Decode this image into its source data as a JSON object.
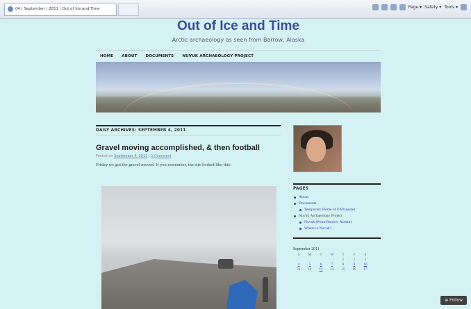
{
  "browser": {
    "tab_title": "04 | September | 2011 | Out of Ice and Time",
    "cmd_page": "Page ▾",
    "cmd_safety": "Safety ▾",
    "cmd_tools": "Tools ▾"
  },
  "site": {
    "title": "Out of Ice and Time",
    "tagline": "Arctic archaeology as seen from Barrow, Alaska"
  },
  "nav": [
    "HOME",
    "ABOUT",
    "DOCUMENTS",
    "NUVUK ARCHAEOLOGY PROJECT"
  ],
  "archive_heading": "DAILY ARCHIVES: SEPTEMBER 4, 2011",
  "post": {
    "title": "Gravel moving accomplished, & then football",
    "meta_prefix": "Posted on",
    "meta_date": "September 4, 2011",
    "meta_sep": "|",
    "meta_comment": "1 Comment",
    "body": "Friday we got the gravel moved.  If you remember, the site looked like this:"
  },
  "sidebar": {
    "pages_heading": "PAGES",
    "pages": [
      {
        "label": "About",
        "level": 0,
        "link": true
      },
      {
        "label": "Documents",
        "level": 0,
        "link": true
      },
      {
        "label": "Temporary Home of EAN poster",
        "level": 1,
        "link": true
      },
      {
        "label": "Nuvuk Archaeology Project",
        "level": 0,
        "link": false
      },
      {
        "label": "Nuvuk (Point Barrow, Alaska)",
        "level": 1,
        "link": true
      },
      {
        "label": "Where is Nuvuk?",
        "level": 1,
        "link": true
      }
    ],
    "calendar": {
      "title": "September 2011",
      "days": [
        "S",
        "M",
        "T",
        "W",
        "T",
        "F",
        "S"
      ],
      "rows": [
        [
          "",
          "",
          "",
          "",
          "1",
          "2",
          "3"
        ],
        [
          "4",
          "5",
          "6",
          "7",
          "8",
          "9",
          "10"
        ],
        [
          "11",
          "12",
          "13",
          "14",
          "15",
          "16",
          "17"
        ]
      ],
      "linked": [
        "4",
        "5",
        "6",
        "7",
        "9",
        "10",
        "13"
      ]
    }
  },
  "follow_button": "⊕ Follow"
}
